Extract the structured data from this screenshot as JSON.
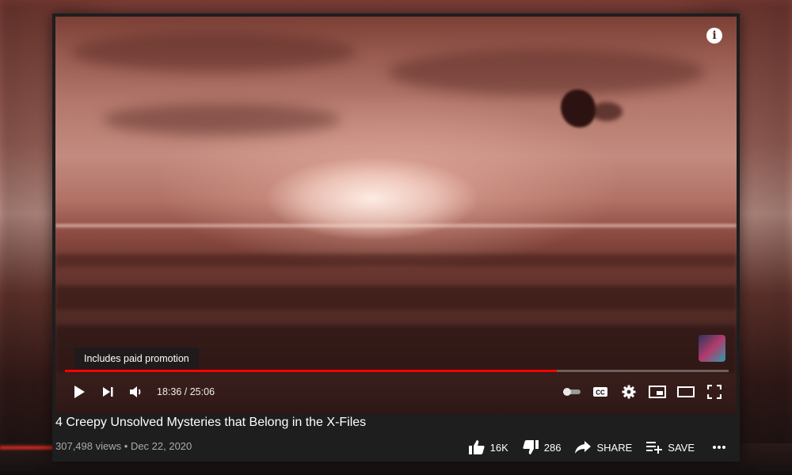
{
  "video": {
    "title": "4 Creepy Unsolved Mysteries that Belong in the X-Files",
    "views": "307,498 views",
    "separator": "•",
    "date": "Dec 22, 2020"
  },
  "player": {
    "promo_label": "Includes paid promotion",
    "current_time": "18:36",
    "time_divider": "/",
    "duration": "25:06",
    "progress_fraction": 0.741,
    "info_glyph": "i"
  },
  "actions": {
    "likes": "16K",
    "dislikes": "286",
    "share_label": "SHARE",
    "save_label": "SAVE"
  },
  "icons": {
    "play": "play-icon",
    "next": "next-icon",
    "volume": "volume-icon",
    "autoplay": "autoplay-toggle-icon",
    "cc": "captions-icon",
    "settings": "gear-icon",
    "miniplayer": "miniplayer-icon",
    "theater": "theater-mode-icon",
    "fullscreen": "fullscreen-icon",
    "like": "thumbs-up-icon",
    "dislike": "thumbs-down-icon",
    "share": "share-icon",
    "save": "playlist-add-icon",
    "more": "more-icon"
  },
  "colors": {
    "progress": "#ff0000",
    "card_bg": "#1e1e1e",
    "meta_text": "#aaaaaa"
  }
}
